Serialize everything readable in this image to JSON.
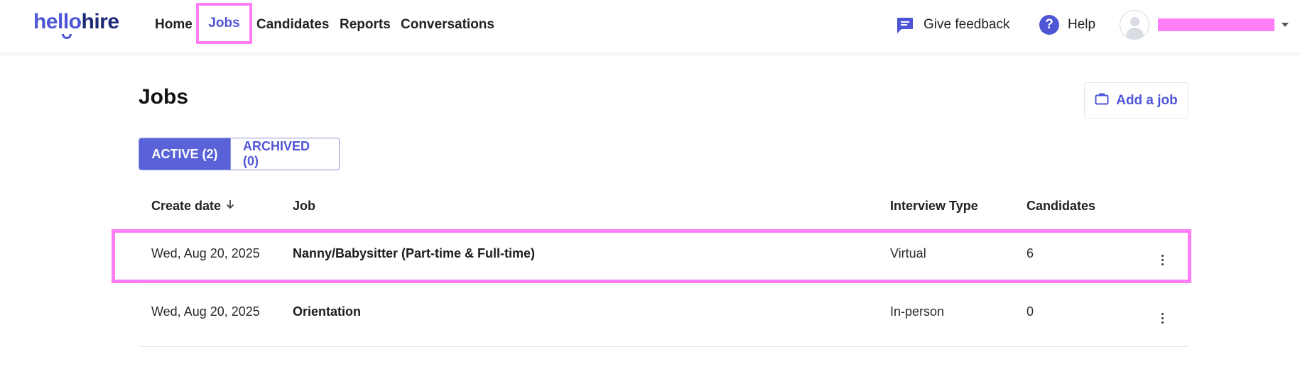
{
  "header": {
    "logo_light": "hello",
    "logo_dark": "hire",
    "nav": [
      {
        "label": "Home"
      },
      {
        "label": "Jobs"
      },
      {
        "label": "Candidates"
      },
      {
        "label": "Reports"
      },
      {
        "label": "Conversations"
      }
    ],
    "feedback_label": "Give feedback",
    "help_label": "Help",
    "username": ""
  },
  "main": {
    "title": "Jobs",
    "add_job_label": "Add a job",
    "tabs": [
      {
        "label": "ACTIVE (2)",
        "active": true
      },
      {
        "label": "ARCHIVED (0)",
        "active": false
      }
    ],
    "columns": {
      "create_date": "Create date",
      "job": "Job",
      "interview_type": "Interview Type",
      "candidates": "Candidates"
    },
    "rows": [
      {
        "create_date": "Wed, Aug 20, 2025",
        "job": "Nanny/Babysitter (Part-time & Full-time)",
        "interview_type": "Virtual",
        "candidates": "6"
      },
      {
        "create_date": "Wed, Aug 20, 2025",
        "job": "Orientation",
        "interview_type": "In-person",
        "candidates": "0"
      }
    ]
  },
  "colors": {
    "accent": "#4f56d6",
    "tab_active_bg": "#5a62d8",
    "highlight": "#ff7ef5"
  },
  "icons": [
    "chat-bubble-icon",
    "help-circle-icon",
    "user-avatar-icon",
    "chevron-down-icon",
    "briefcase-icon",
    "sort-down-arrow-icon",
    "kebab-menu-icon"
  ]
}
